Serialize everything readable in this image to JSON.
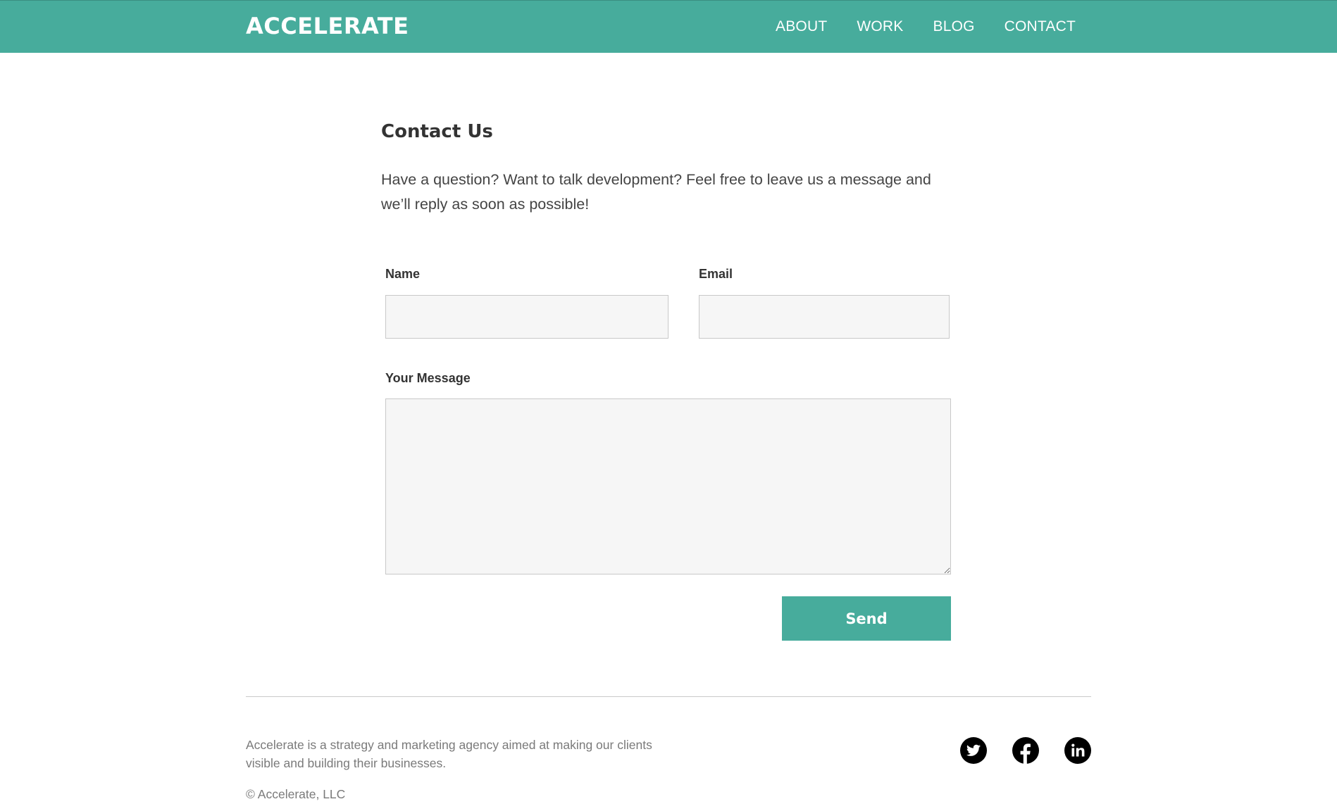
{
  "header": {
    "logo": "ACCELERATE",
    "nav": [
      {
        "label": "ABOUT"
      },
      {
        "label": "WORK"
      },
      {
        "label": "BLOG"
      },
      {
        "label": "CONTACT"
      }
    ]
  },
  "main": {
    "title": "Contact Us",
    "intro": "Have a question? Want to talk development? Feel free to leave us a message and we’ll reply as soon as possible!",
    "form": {
      "name_label": "Name",
      "name_value": "",
      "email_label": "Email",
      "email_value": "",
      "message_label": "Your Message",
      "message_value": "",
      "send_label": "Send"
    }
  },
  "footer": {
    "description": "Accelerate is a strategy and marketing agency aimed at making our clients visible and building their businesses.",
    "copyright": "© Accelerate, LLC",
    "social": [
      {
        "icon": "twitter-icon"
      },
      {
        "icon": "facebook-icon"
      },
      {
        "icon": "linkedin-icon"
      }
    ]
  },
  "colors": {
    "accent": "#47ac9c",
    "input_background": "#f6f6f6",
    "footer_text": "#7a7a7a"
  }
}
